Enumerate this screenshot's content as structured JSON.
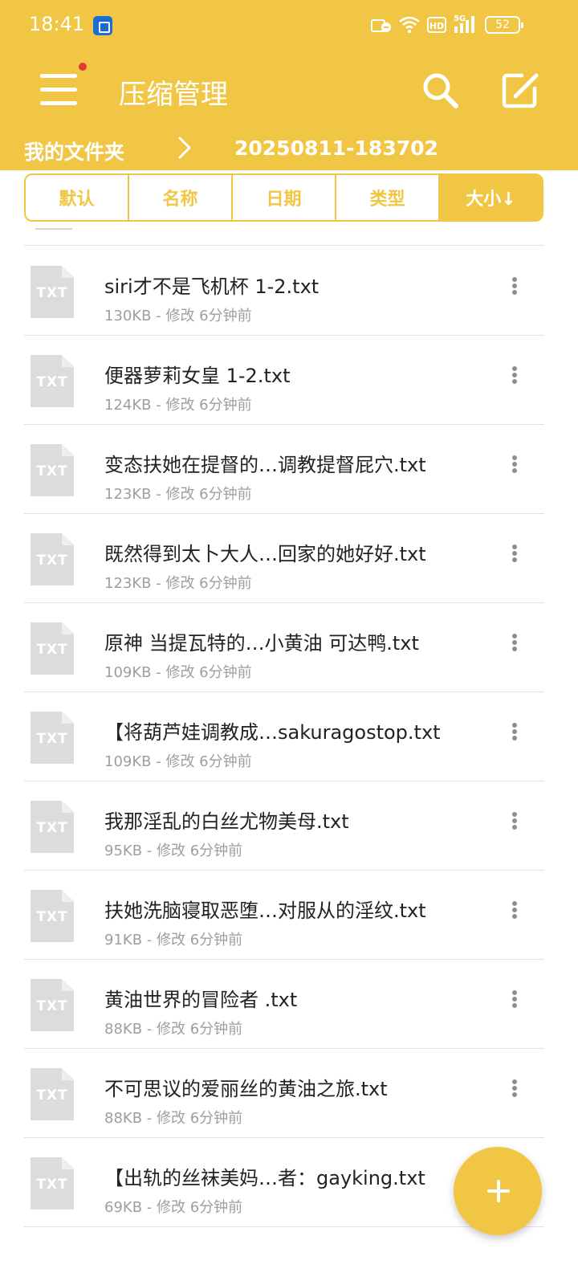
{
  "theme": {
    "accent": "#f1c644"
  },
  "status_bar": {
    "time": "18:41",
    "battery": "52",
    "icons": [
      "nfc-icon",
      "wifi-icon",
      "hd-icon",
      "5g-signal-icon",
      "battery-icon"
    ]
  },
  "app_bar": {
    "title": "压缩管理",
    "menu_icon": "hamburger-menu-icon",
    "search_icon": "search-icon",
    "edit_icon": "edit-icon"
  },
  "breadcrumb": {
    "root": "我的文件夹",
    "separator": ">",
    "current": "20250811-183702"
  },
  "sort_tabs": [
    {
      "label": "默认",
      "active": false
    },
    {
      "label": "名称",
      "active": false
    },
    {
      "label": "日期",
      "active": false
    },
    {
      "label": "类型",
      "active": false
    },
    {
      "label": "大小↓",
      "active": true
    }
  ],
  "files": [
    {
      "icon": "TXT",
      "name": "siri才不是飞机杯 1-2.txt",
      "meta": "130KB - 修改 6分钟前"
    },
    {
      "icon": "TXT",
      "name": "便器萝莉女皇 1-2.txt",
      "meta": "124KB - 修改 6分钟前"
    },
    {
      "icon": "TXT",
      "name": "变态扶她在提督的…调教提督屁穴.txt",
      "meta": "123KB - 修改 6分钟前"
    },
    {
      "icon": "TXT",
      "name": "既然得到太卜大人…回家的她好好.txt",
      "meta": "123KB - 修改 6分钟前"
    },
    {
      "icon": "TXT",
      "name": "原神 当提瓦特的…小黄油 可达鸭.txt",
      "meta": "109KB - 修改 6分钟前"
    },
    {
      "icon": "TXT",
      "name": "【将葫芦娃调教成…sakuragostop.txt",
      "meta": "109KB - 修改 6分钟前"
    },
    {
      "icon": "TXT",
      "name": "我那淫乱的白丝尤物美母.txt",
      "meta": "95KB - 修改 6分钟前"
    },
    {
      "icon": "TXT",
      "name": "扶她洗脑寝取恶堕…对服从的淫纹.txt",
      "meta": "91KB - 修改 6分钟前"
    },
    {
      "icon": "TXT",
      "name": "黄油世界的冒险者  .txt",
      "meta": "88KB - 修改 6分钟前"
    },
    {
      "icon": "TXT",
      "name": "不可思议的爱丽丝的黄油之旅.txt",
      "meta": "88KB - 修改 6分钟前"
    },
    {
      "icon": "TXT",
      "name": "【出轨的丝袜美妈…者：gayking.txt",
      "meta": "69KB - 修改 6分钟前"
    }
  ],
  "fab": {
    "icon": "plus-icon"
  }
}
